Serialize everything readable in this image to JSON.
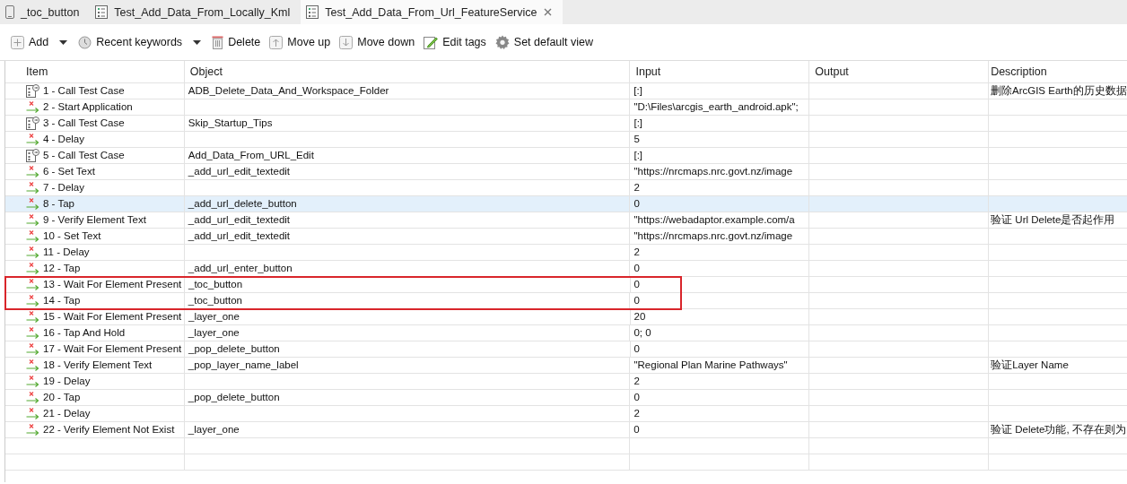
{
  "tabs": [
    {
      "label": "_toc_button",
      "kind": "device",
      "selected": false,
      "closable": false
    },
    {
      "label": "Test_Add_Data_From_Locally_Kml",
      "kind": "testcase",
      "selected": false,
      "closable": false
    },
    {
      "label": "Test_Add_Data_From_Url_FeatureService",
      "kind": "testcase",
      "selected": true,
      "closable": true
    }
  ],
  "toolbar": [
    {
      "label": "Add",
      "kind": "add",
      "dropdown": true
    },
    {
      "label": "Recent keywords",
      "kind": "clock",
      "dropdown": true
    },
    {
      "label": "Delete",
      "kind": "trash",
      "dropdown": false
    },
    {
      "label": "Move up",
      "kind": "up",
      "dropdown": false
    },
    {
      "label": "Move down",
      "kind": "down",
      "dropdown": false
    },
    {
      "label": "Edit tags",
      "kind": "tag",
      "dropdown": false
    },
    {
      "label": "Set default view",
      "kind": "gear",
      "dropdown": false
    }
  ],
  "table": {
    "columns": [
      "Item",
      "Object",
      "Input",
      "Output",
      "Description"
    ],
    "rows": [
      {
        "kind": "call",
        "item": "1 - Call Test Case",
        "object": "ADB_Delete_Data_And_Workspace_Folder",
        "input": "[:]",
        "description": "删除ArcGIS Earth的历史数据",
        "selected": false,
        "boxed": false
      },
      {
        "kind": "action",
        "item": "2 - Start Application",
        "input": "\"D:\\Files\\arcgis_earth_android.apk\";",
        "selected": false,
        "boxed": false
      },
      {
        "kind": "call",
        "item": "3 - Call Test Case",
        "object": "Skip_Startup_Tips",
        "input": "[:]",
        "selected": false,
        "boxed": false
      },
      {
        "kind": "action",
        "item": "4 - Delay",
        "input": "5",
        "selected": false,
        "boxed": false
      },
      {
        "kind": "call",
        "item": "5 - Call Test Case",
        "object": "Add_Data_From_URL_Edit",
        "input": "[:]",
        "selected": false,
        "boxed": false
      },
      {
        "kind": "action",
        "item": "6 - Set Text",
        "object": "_add_url_edit_textedit",
        "input": "\"https://nrcmaps.nrc.govt.nz/image",
        "selected": false,
        "boxed": false
      },
      {
        "kind": "action",
        "item": "7 - Delay",
        "input": "2",
        "selected": false,
        "boxed": false
      },
      {
        "kind": "action",
        "item": "8 - Tap",
        "object": "_add_url_delete_button",
        "input": "0",
        "selected": true,
        "boxed": false
      },
      {
        "kind": "action",
        "item": "9 - Verify Element Text",
        "object": "_add_url_edit_textedit",
        "input": "\"https://webadaptor.example.com/a",
        "description": "验证 Url Delete是否起作用",
        "selected": false,
        "boxed": false
      },
      {
        "kind": "action",
        "item": "10 - Set Text",
        "object": "_add_url_edit_textedit",
        "input": "\"https://nrcmaps.nrc.govt.nz/image",
        "selected": false,
        "boxed": false
      },
      {
        "kind": "action",
        "item": "11 - Delay",
        "input": "2",
        "selected": false,
        "boxed": false
      },
      {
        "kind": "action",
        "item": "12 - Tap",
        "object": "_add_url_enter_button",
        "input": "0",
        "selected": false,
        "boxed": false
      },
      {
        "kind": "action",
        "item": "13 - Wait For Element Present",
        "object": "_toc_button",
        "input": "0",
        "selected": false,
        "boxed": true
      },
      {
        "kind": "action",
        "item": "14 - Tap",
        "object": "_toc_button",
        "input": "0",
        "selected": false,
        "boxed": true
      },
      {
        "kind": "action",
        "item": "15 - Wait For Element Present",
        "object": "_layer_one",
        "input": "20",
        "selected": false,
        "boxed": false
      },
      {
        "kind": "action",
        "item": "16 - Tap And Hold",
        "object": "_layer_one",
        "input": "0; 0",
        "selected": false,
        "boxed": false
      },
      {
        "kind": "action",
        "item": "17 - Wait For Element Present",
        "object": "_pop_delete_button",
        "input": "0",
        "selected": false,
        "boxed": false
      },
      {
        "kind": "action",
        "item": "18 - Verify Element Text",
        "object": "_pop_layer_name_label",
        "input": "\"Regional Plan Marine Pathways\"",
        "description": "验证Layer Name",
        "selected": false,
        "boxed": false
      },
      {
        "kind": "action",
        "item": "19 - Delay",
        "input": "2",
        "selected": false,
        "boxed": false
      },
      {
        "kind": "action",
        "item": "20 - Tap",
        "object": "_pop_delete_button",
        "input": "0",
        "selected": false,
        "boxed": false
      },
      {
        "kind": "action",
        "item": "21 - Delay",
        "input": "2",
        "selected": false,
        "boxed": false
      },
      {
        "kind": "action",
        "item": "22 - Verify Element Not Exist",
        "object": "_layer_one",
        "input": "0",
        "description": "验证 Delete功能, 不存在则为",
        "selected": false,
        "boxed": false
      }
    ]
  }
}
